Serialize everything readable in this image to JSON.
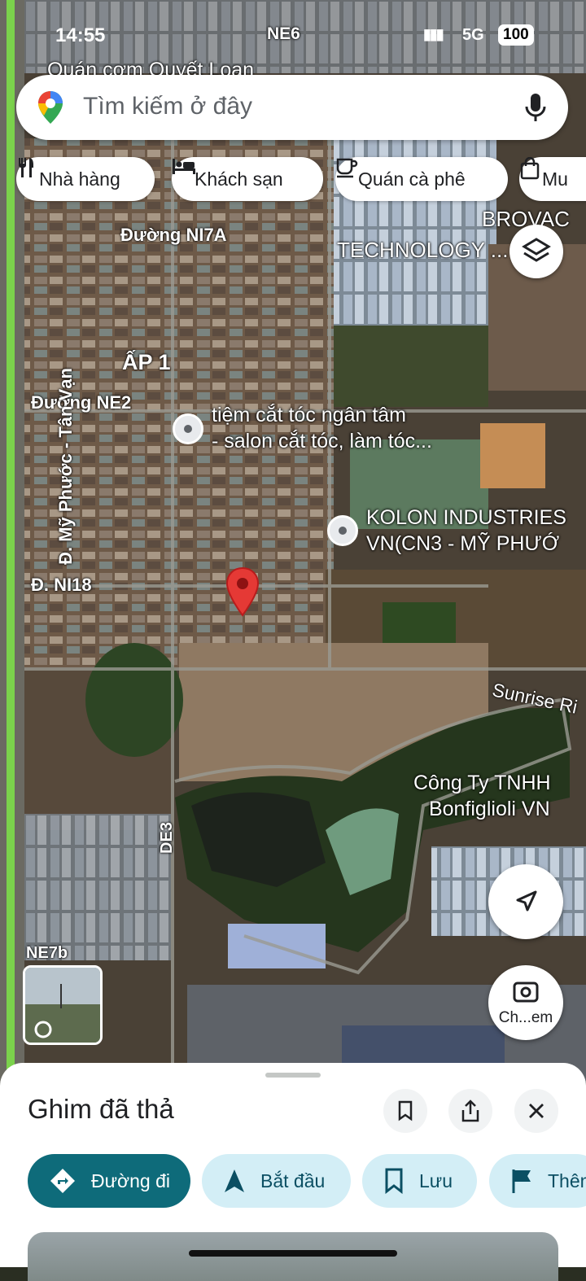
{
  "status": {
    "time": "14:55",
    "network": "5G",
    "battery": "100",
    "location_arrow": "location-arrow-icon"
  },
  "search": {
    "placeholder": "Tìm kiếm ở đây"
  },
  "chips": [
    {
      "label": "Nhà hàng",
      "icon": "fork-knife-icon"
    },
    {
      "label": "Khách sạn",
      "icon": "bed-icon"
    },
    {
      "label": "Quán cà phê",
      "icon": "coffee-cup-icon"
    },
    {
      "label": "Mu",
      "icon": "shopping-bag-icon"
    }
  ],
  "map": {
    "labels": {
      "ne6": "NE6",
      "quan_com": "Quán cơm Quyết Loan",
      "ni7a": "Đường NI7A",
      "brovac1": "BROVAC",
      "brovac2": "TECHNOLOGY ...",
      "ap1": "ẤP 1",
      "ne2": "Đường NE2",
      "my_phuoc": "Đ. Mỹ Phước - Tân Vạn",
      "ni18": "Đ. NI18",
      "sunrise": "Sunrise Ri",
      "de3": "DE3",
      "ne7b": "NE7b"
    },
    "pois": {
      "salon1": "tiệm cắt tóc ngân tâm",
      "salon2": "- salon cắt tóc, làm tóc...",
      "kolon1": "KOLON INDUSTRIES",
      "kolon2": "VN(CN3 - MỸ PHƯỚ",
      "bonfi1": "Công Ty TNHH",
      "bonfi2": "Bonfiglioli VN"
    },
    "camera_label": "Ch...em",
    "colors": {
      "pin": "#e53935",
      "road_highlight": "#7bd24c"
    }
  },
  "sheet": {
    "title": "Ghim đã thả",
    "actions": [
      {
        "label": "Đường đi",
        "icon": "directions-icon"
      },
      {
        "label": "Bắt đầu",
        "icon": "navigation-arrow-icon"
      },
      {
        "label": "Lưu",
        "icon": "bookmark-icon"
      },
      {
        "label": "Thêm",
        "icon": "flag-icon"
      }
    ],
    "colors": {
      "primary": "#0e6b7a",
      "secondary": "#d3eef6"
    }
  }
}
